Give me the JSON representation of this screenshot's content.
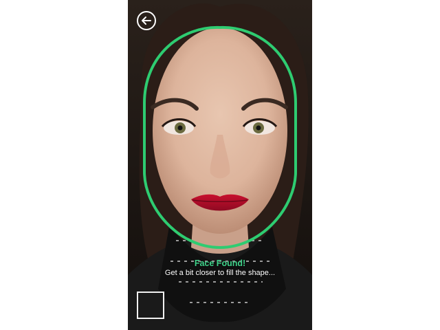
{
  "screen": {
    "back_icon": "back-arrow-icon",
    "face_guide_color": "#2ecc71",
    "status": {
      "title": "Face Found!",
      "subtitle": "Get a bit closer to fill the shape..."
    },
    "capture_icon": "square-frame-icon"
  }
}
